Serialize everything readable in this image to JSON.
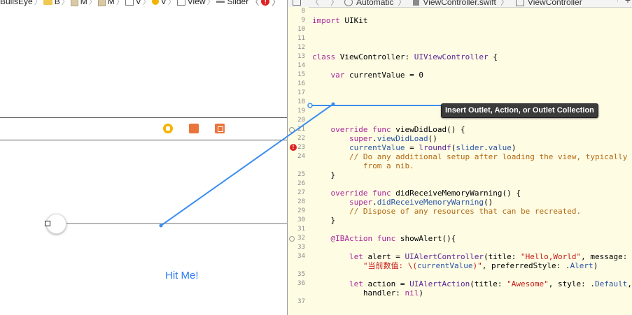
{
  "breadcrumb": {
    "project": "BullsEye",
    "items": [
      "B",
      "M",
      "M",
      "V",
      "V",
      "View",
      "Slider"
    ],
    "error_badge": "!"
  },
  "scene": {
    "button_label": "Hit Me!"
  },
  "editor": {
    "jumpbar": {
      "mode": "Automatic",
      "file": "ViewController.swift",
      "symbol": "ViewController",
      "add": "+"
    },
    "lines": [
      {
        "n": "8",
        "segs": []
      },
      {
        "n": "9",
        "segs": [
          [
            "kw",
            "import"
          ],
          [
            "",
            " UIKit"
          ]
        ]
      },
      {
        "n": "10",
        "segs": []
      },
      {
        "n": "11",
        "segs": []
      },
      {
        "n": "12",
        "segs": []
      },
      {
        "n": "13",
        "segs": [
          [
            "kw",
            "class"
          ],
          [
            "",
            " ViewController: "
          ],
          [
            "ty",
            "UIViewController"
          ],
          [
            "",
            " {"
          ]
        ]
      },
      {
        "n": "14",
        "segs": []
      },
      {
        "n": "15",
        "segs": [
          [
            "",
            "    "
          ],
          [
            "kw",
            "var"
          ],
          [
            "",
            " currentValue = "
          ],
          [
            "",
            "0"
          ]
        ]
      },
      {
        "n": "16",
        "segs": []
      },
      {
        "n": "17",
        "segs": []
      },
      {
        "n": "18",
        "segs": []
      },
      {
        "n": "19",
        "segs": []
      },
      {
        "n": "20",
        "segs": []
      },
      {
        "n": "21",
        "marker": "bp",
        "segs": [
          [
            "",
            "    "
          ],
          [
            "kw",
            "override"
          ],
          [
            "",
            " "
          ],
          [
            "kw",
            "func"
          ],
          [
            "",
            " viewDidLoad() {"
          ]
        ]
      },
      {
        "n": "22",
        "segs": [
          [
            "",
            "        "
          ],
          [
            "kw",
            "super"
          ],
          [
            "",
            "."
          ],
          [
            "mem",
            "viewDidLoad"
          ],
          [
            "",
            "()"
          ]
        ]
      },
      {
        "n": "23",
        "marker": "err",
        "segs": [
          [
            "",
            "        "
          ],
          [
            "mem",
            "currentValue"
          ],
          [
            "",
            " = "
          ],
          [
            "ty",
            "lroundf"
          ],
          [
            "",
            "("
          ],
          [
            "mem",
            "slider"
          ],
          [
            "",
            "."
          ],
          [
            "mem",
            "value"
          ],
          [
            "",
            ")"
          ]
        ]
      },
      {
        "n": "24",
        "segs": [
          [
            "",
            "        "
          ],
          [
            "cm",
            "// Do any additional setup after loading the view, typically"
          ]
        ]
      },
      {
        "n": "",
        "segs": [
          [
            "",
            "           "
          ],
          [
            "cm",
            "from a nib."
          ]
        ]
      },
      {
        "n": "25",
        "segs": [
          [
            "",
            "    }"
          ]
        ]
      },
      {
        "n": "26",
        "segs": []
      },
      {
        "n": "27",
        "segs": [
          [
            "",
            "    "
          ],
          [
            "kw",
            "override"
          ],
          [
            "",
            " "
          ],
          [
            "kw",
            "func"
          ],
          [
            "",
            " didReceiveMemoryWarning() {"
          ]
        ]
      },
      {
        "n": "28",
        "segs": [
          [
            "",
            "        "
          ],
          [
            "kw",
            "super"
          ],
          [
            "",
            "."
          ],
          [
            "mem",
            "didReceiveMemoryWarning"
          ],
          [
            "",
            "()"
          ]
        ]
      },
      {
        "n": "29",
        "segs": [
          [
            "",
            "        "
          ],
          [
            "cm",
            "// Dispose of any resources that can be recreated."
          ]
        ]
      },
      {
        "n": "30",
        "segs": [
          [
            "",
            "    }"
          ]
        ]
      },
      {
        "n": "31",
        "segs": []
      },
      {
        "n": "32",
        "marker": "bp",
        "segs": [
          [
            "",
            "    "
          ],
          [
            "kw",
            "@IBAction"
          ],
          [
            "",
            " "
          ],
          [
            "kw",
            "func"
          ],
          [
            "",
            " showAlert(){"
          ]
        ]
      },
      {
        "n": "33",
        "segs": []
      },
      {
        "n": "34",
        "segs": [
          [
            "",
            "        "
          ],
          [
            "kw",
            "let"
          ],
          [
            "",
            " alert = "
          ],
          [
            "ty",
            "UIAlertController"
          ],
          [
            "",
            "(title: "
          ],
          [
            "str",
            "\"Hello,World\""
          ],
          [
            "",
            ", message:"
          ]
        ]
      },
      {
        "n": "",
        "segs": [
          [
            "",
            "           "
          ],
          [
            "str",
            "\"当前数值: \\("
          ],
          [
            "mem",
            "currentValue"
          ],
          [
            "str",
            ")\""
          ],
          [
            "",
            ", preferredStyle: ."
          ],
          [
            "mem",
            "Alert"
          ],
          [
            "",
            ")"
          ]
        ]
      },
      {
        "n": "35",
        "segs": []
      },
      {
        "n": "36",
        "segs": [
          [
            "",
            "        "
          ],
          [
            "kw",
            "let"
          ],
          [
            "",
            " action = "
          ],
          [
            "ty",
            "UIAlertAction"
          ],
          [
            "",
            "(title: "
          ],
          [
            "str",
            "\"Awesome\""
          ],
          [
            "",
            ", style: ."
          ],
          [
            "mem",
            "Default"
          ],
          [
            "",
            ","
          ]
        ]
      },
      {
        "n": "",
        "segs": [
          [
            "",
            "           handler: "
          ],
          [
            "kw",
            "nil"
          ],
          [
            "",
            ")"
          ]
        ]
      },
      {
        "n": "37",
        "segs": []
      }
    ]
  },
  "connection": {
    "tooltip": "Insert Outlet, Action, or Outlet Collection",
    "color": "#3b8ef0"
  }
}
